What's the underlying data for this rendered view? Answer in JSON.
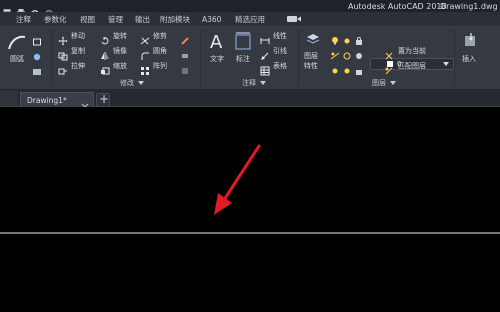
{
  "window": {
    "title_left": "Autodesk AutoCAD 2018",
    "title_right": "Drawing1.dwg"
  },
  "menubar": {
    "items": [
      "注释",
      "参数化",
      "视图",
      "管理",
      "输出",
      "附加模块",
      "A360",
      "精选应用"
    ]
  },
  "ribbon": {
    "draw": {
      "label": "圆弧"
    },
    "modify": {
      "title": "修改",
      "items": {
        "move": "移动",
        "rotate": "旋转",
        "trim": "修剪",
        "copy": "复制",
        "mirror": "镜像",
        "fillet": "圆角",
        "stretch": "拉伸",
        "scale": "缩放",
        "array": "阵列"
      }
    },
    "annotation": {
      "title": "注释",
      "text": "文字",
      "dimension": "标注",
      "linear": "线性",
      "leader": "引线",
      "table": "表格"
    },
    "layers": {
      "title": "图层",
      "layer_props_line1": "图层",
      "layer_props_line2": "特性",
      "current_layer_value": "0",
      "set_current": "置为当前",
      "match_layer": "匹配图层"
    },
    "block": {
      "insert": "插入"
    }
  },
  "tabs": {
    "active": "Drawing1*",
    "add_symbol": "+"
  },
  "colors": {
    "annotation_arrow": "#e01b24",
    "canvas_line": "#ffffff"
  }
}
